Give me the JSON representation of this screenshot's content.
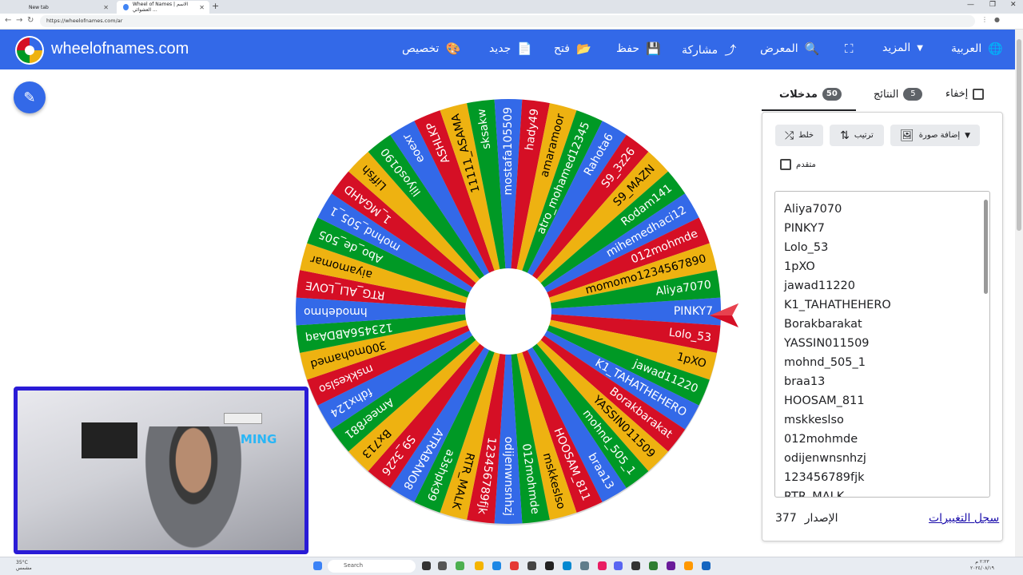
{
  "browser": {
    "tabs": [
      {
        "title": "New tab"
      },
      {
        "title": "Wheel of Names | الاسم العشوائي ..."
      }
    ],
    "url": "https://wheelofnames.com/ar"
  },
  "header": {
    "brand": "wheelofnames.com",
    "menu": [
      {
        "label": "تخصيص",
        "icon": "palette-icon",
        "glyph": "🎨"
      },
      {
        "label": "جديد",
        "icon": "new-file-icon",
        "glyph": "📄"
      },
      {
        "label": "فتح",
        "icon": "folder-icon",
        "glyph": "📂"
      },
      {
        "label": "حفظ",
        "icon": "save-icon",
        "glyph": "💾"
      },
      {
        "label": "مشاركة",
        "icon": "share-icon",
        "glyph": "⤴"
      },
      {
        "label": "المعرض",
        "icon": "search-icon",
        "glyph": "🔍"
      },
      {
        "label": "",
        "icon": "fullscreen-icon",
        "glyph": "⛶"
      },
      {
        "label": "المزيد",
        "icon": "dropdown-icon",
        "glyph": "▼"
      },
      {
        "label": "العربية",
        "icon": "globe-icon",
        "glyph": "🌐"
      }
    ]
  },
  "panel": {
    "hide_label": "إخفاء",
    "results_label": "النتائج",
    "results_count": "5",
    "entries_label": "مدخلات",
    "entries_count": "50",
    "shuffle_label": "خلط",
    "sort_label": "ترتيب",
    "add_image_label": "إضافة صورة",
    "advanced_label": "متقدم",
    "version_label": "الإصدار",
    "version_number": "377",
    "changelog_label": "سجل التغييرات",
    "entries_visible": [
      "Aliya7070",
      "PINKY7",
      "Lolo_53",
      "1pXO",
      "jawad11220",
      "K1_TAHATHEHERO",
      "Borakbarakat",
      "YASSIN011509",
      "mohnd_505_1",
      "braa13",
      "HOOSAM_811",
      "mskkeslso",
      "012mohmde",
      "odijenwnsnhzj",
      "123456789fjk",
      "RTR_MALK"
    ]
  },
  "wheel": {
    "colors": [
      "#3369e8",
      "#d50f25",
      "#eeb211",
      "#009925"
    ],
    "segments": [
      "PINKY7",
      "Lolo_53",
      "1pXO",
      "jawad11220",
      "K1_TAHATHEHERO",
      "Borakbarakat",
      "YASSIN011509",
      "mohnd_505_1",
      "braa13",
      "HOOSAM_811",
      "mskkeslso",
      "012mohmde",
      "odijenwnsnhzj",
      "123456789fjk",
      "RTR_MALK",
      "a3shpk99",
      "ATRABANO8",
      "S9_3z26",
      "Bx713",
      "Ameer881",
      "fdhx124",
      "mskkeslso",
      "300mohamed",
      "123456ABDAaq",
      "hmodehmo",
      "RTG_ALI_LOVE",
      "aiyamomar",
      "Abo_de_505",
      "mohnd_505_1",
      "1_MGAHD",
      "Liffsh",
      "lilyos0190",
      "eoexr",
      "ASHLKP",
      "11111_ASAMA",
      "sksakw",
      "mostafa105509",
      "hady49",
      "amaramoor",
      "atro_mohamed12345...",
      "Rahota6",
      "S9_3z26",
      "S9_MAZN",
      "Rodam141",
      "mihemedhaci12",
      "012mohmde",
      "momomo1234567890",
      "Aliya7070"
    ]
  },
  "webcam": {
    "overlay_text": "GAMING"
  },
  "taskbar": {
    "weather": "35°C",
    "weather_desc": "مشمس",
    "search_placeholder": "Search",
    "time": "٢:٢٣ م",
    "date": "٢٠٢٤/٠٨/١٩"
  }
}
